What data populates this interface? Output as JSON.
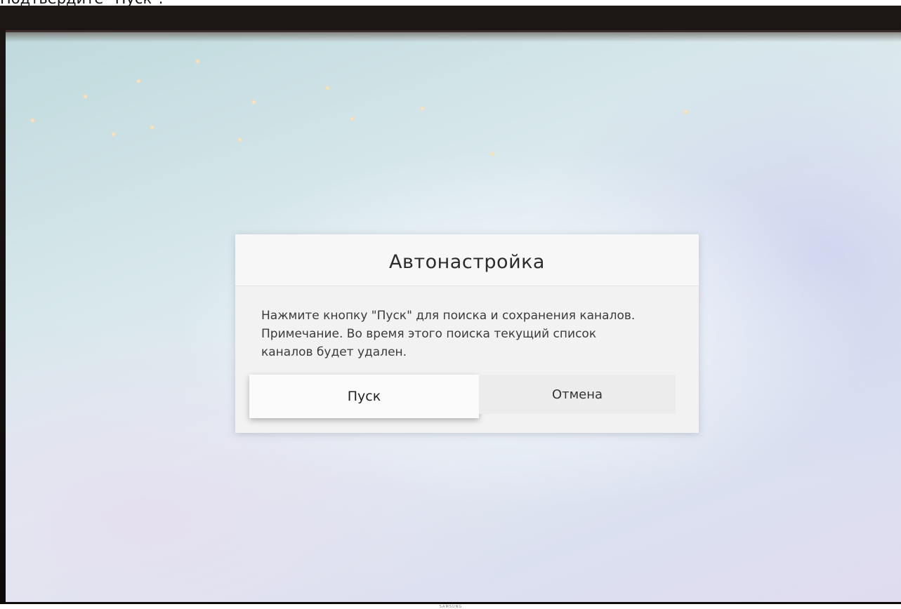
{
  "caption": "Подтвердите \"Пуск\".",
  "dialog": {
    "title": "Автонастройка",
    "message_lines": [
      "Нажмите кнопку \"Пуск\" для поиска и сохранения каналов.",
      "Примечание. Во время этого поиска текущий список",
      "каналов будет удален."
    ],
    "start_label": "Пуск",
    "cancel_label": "Отмена"
  },
  "tv": {
    "brand": "SAMSUNG"
  },
  "colors": {
    "dialog_bg": "#f2f2f2",
    "focused_button_bg": "#fbfbfb",
    "screen_bg": "#d5e6ea"
  }
}
